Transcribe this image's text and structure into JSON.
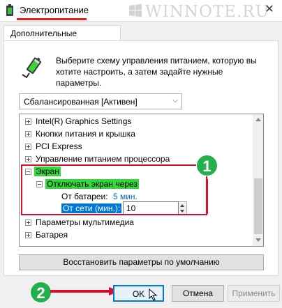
{
  "window": {
    "title": "Электропитание",
    "close_glyph": "✕",
    "watermark": "WINNOTE.RU",
    "icon": "power-options-icon"
  },
  "tab": {
    "label": "Дополнительные параметры"
  },
  "description": "Выберите схему управления питанием, которую вы хотите настроить, а затем задайте нужные параметры.",
  "plan_select": {
    "value": "Сбалансированная [Активен]"
  },
  "tree": {
    "items": [
      {
        "label": "Intel(R) Graphics Settings",
        "expanded": false
      },
      {
        "label": "Кнопки питания и крышка",
        "expanded": false
      },
      {
        "label": "PCI Express",
        "expanded": false
      },
      {
        "label": "Управление питанием процессора",
        "expanded": false
      },
      {
        "label": "Экран",
        "expanded": true
      },
      {
        "label": "Отключать экран через",
        "expanded": true
      },
      {
        "label": "Параметры мультимедиа",
        "expanded": false
      },
      {
        "label": "Батарея",
        "expanded": false
      }
    ],
    "on_battery_label": "От батареи:",
    "on_battery_value": "5 мин.",
    "plugged_in_label": "От сети (мин.):",
    "plugged_in_value": "10"
  },
  "restore_button": "Восстановить параметры по умолчанию",
  "buttons": {
    "ok": "OK",
    "cancel": "Отмена",
    "apply": "Применить"
  },
  "annotations": {
    "step1": "1",
    "step2": "2"
  },
  "colors": {
    "highlight_green": "#33d83a",
    "selection_blue": "#0078d7",
    "annotation_red": "#d9102c",
    "badge_green": "#23b14d"
  }
}
